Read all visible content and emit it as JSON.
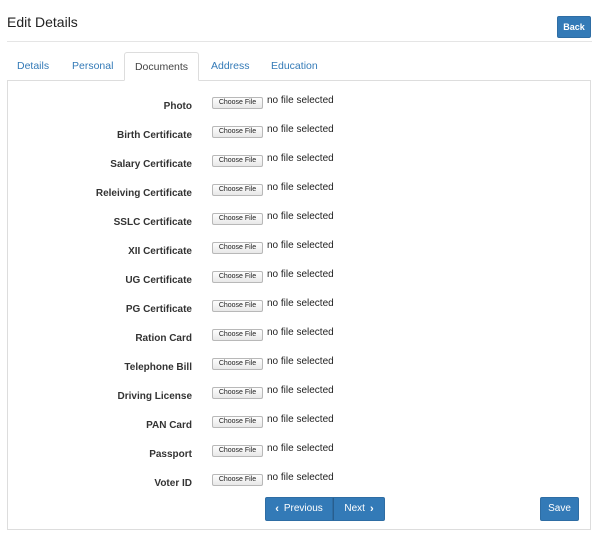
{
  "header": {
    "title": "Edit Details",
    "back_label": "Back"
  },
  "tabs": [
    {
      "label": "Details",
      "active": false
    },
    {
      "label": "Personal",
      "active": false
    },
    {
      "label": "Documents",
      "active": true
    },
    {
      "label": "Address",
      "active": false
    },
    {
      "label": "Education",
      "active": false
    }
  ],
  "documents": [
    {
      "label": "Photo",
      "button": "Choose File",
      "status": "no file selected"
    },
    {
      "label": "Birth Certificate",
      "button": "Choose File",
      "status": "no file selected"
    },
    {
      "label": "Salary Certificate",
      "button": "Choose File",
      "status": "no file selected"
    },
    {
      "label": "Releiving Certificate",
      "button": "Choose File",
      "status": "no file selected"
    },
    {
      "label": "SSLC Certificate",
      "button": "Choose File",
      "status": "no file selected"
    },
    {
      "label": "XII Certificate",
      "button": "Choose File",
      "status": "no file selected"
    },
    {
      "label": "UG Certificate",
      "button": "Choose File",
      "status": "no file selected"
    },
    {
      "label": "PG Certificate",
      "button": "Choose File",
      "status": "no file selected"
    },
    {
      "label": "Ration Card",
      "button": "Choose File",
      "status": "no file selected"
    },
    {
      "label": "Telephone Bill",
      "button": "Choose File",
      "status": "no file selected"
    },
    {
      "label": "Driving License",
      "button": "Choose File",
      "status": "no file selected"
    },
    {
      "label": "PAN Card",
      "button": "Choose File",
      "status": "no file selected"
    },
    {
      "label": "Passport",
      "button": "Choose File",
      "status": "no file selected"
    },
    {
      "label": "Voter ID",
      "button": "Choose File",
      "status": "no file selected"
    }
  ],
  "pager": {
    "previous_label": "Previous",
    "next_label": "Next",
    "previous_icon": "chevron-left-icon",
    "next_icon": "chevron-right-icon"
  },
  "footer": {
    "save_label": "Save"
  },
  "colors": {
    "primary": "#337ab7",
    "link": "#337ab7",
    "border": "#dddddd"
  }
}
